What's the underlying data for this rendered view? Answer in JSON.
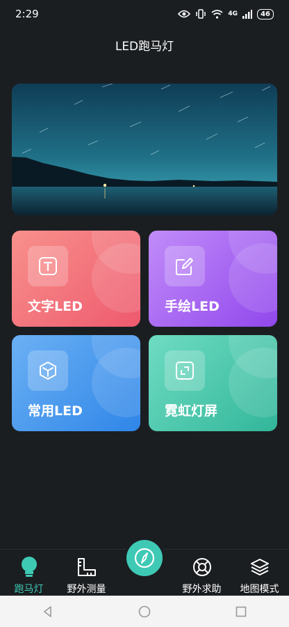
{
  "status_bar": {
    "time": "2:29",
    "network": "4G",
    "battery": "46"
  },
  "header": {
    "title": "LED跑马灯"
  },
  "cards": [
    {
      "label": "文字LED",
      "icon": "text-t-icon",
      "color": "#ef6676"
    },
    {
      "label": "手绘LED",
      "icon": "pencil-edit-icon",
      "color": "#a562ef"
    },
    {
      "label": "常用LED",
      "icon": "cube-icon",
      "color": "#4596ec"
    },
    {
      "label": "霓虹灯屏",
      "icon": "expand-corners-icon",
      "color": "#44c2a6"
    }
  ],
  "bottom_nav": {
    "items": [
      {
        "label": "跑马灯",
        "icon": "bulb-icon",
        "active": true
      },
      {
        "label": "野外测量",
        "icon": "ruler-icon",
        "active": false
      },
      {
        "label": "",
        "icon": "compass-icon",
        "active": false
      },
      {
        "label": "野外求助",
        "icon": "lifebuoy-icon",
        "active": false
      },
      {
        "label": "地图模式",
        "icon": "layers-icon",
        "active": false
      }
    ]
  },
  "colors": {
    "accent": "#3ec9b5",
    "background": "#1b1e21"
  }
}
